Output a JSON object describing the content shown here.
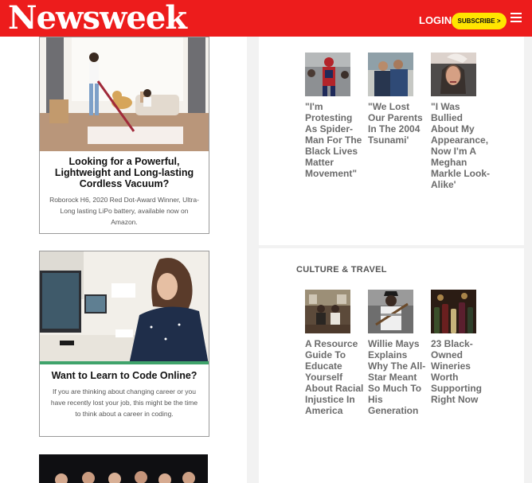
{
  "header": {
    "logo": "Newsweek",
    "login_label": "LOGIN",
    "subscribe_label": "SUBSCRIBE >",
    "menu_icon": "hamburger-menu-icon",
    "brand_color": "#ed1c1c",
    "subscribe_color": "#ffe500"
  },
  "ads": [
    {
      "title": "Looking for a Powerful, Lightweight and Long-lasting Cordless Vacuum?",
      "description": "Roborock H6, 2020 Red Dot-Award Winner, Ultra-Long lasting LiPo battery, available now on Amazon."
    },
    {
      "title": "Want to Learn to Code Online?",
      "description": "If you are thinking about changing career or you have recently lost your job, this might be the time to think about a career in coding."
    }
  ],
  "top_stories": [
    {
      "caption": "\"I'm Protesting As Spider-Man For The Black Lives Matter Movement\""
    },
    {
      "caption": "\"We Lost Our Parents In The 2004 Tsunami'"
    },
    {
      "caption": "\"I Was Bullied About My Appearance, Now I'm A Meghan Markle Look-Alike'"
    }
  ],
  "culture_travel": {
    "title": "CULTURE & TRAVEL",
    "stories": [
      {
        "caption": "A Resource Guide To Educate Yourself About Racial Injustice In America"
      },
      {
        "caption": "Willie Mays Explains Why The All-Star Meant So Much To His Generation"
      },
      {
        "caption": "23 Black-Owned Wineries Worth Supporting Right Now"
      }
    ]
  }
}
